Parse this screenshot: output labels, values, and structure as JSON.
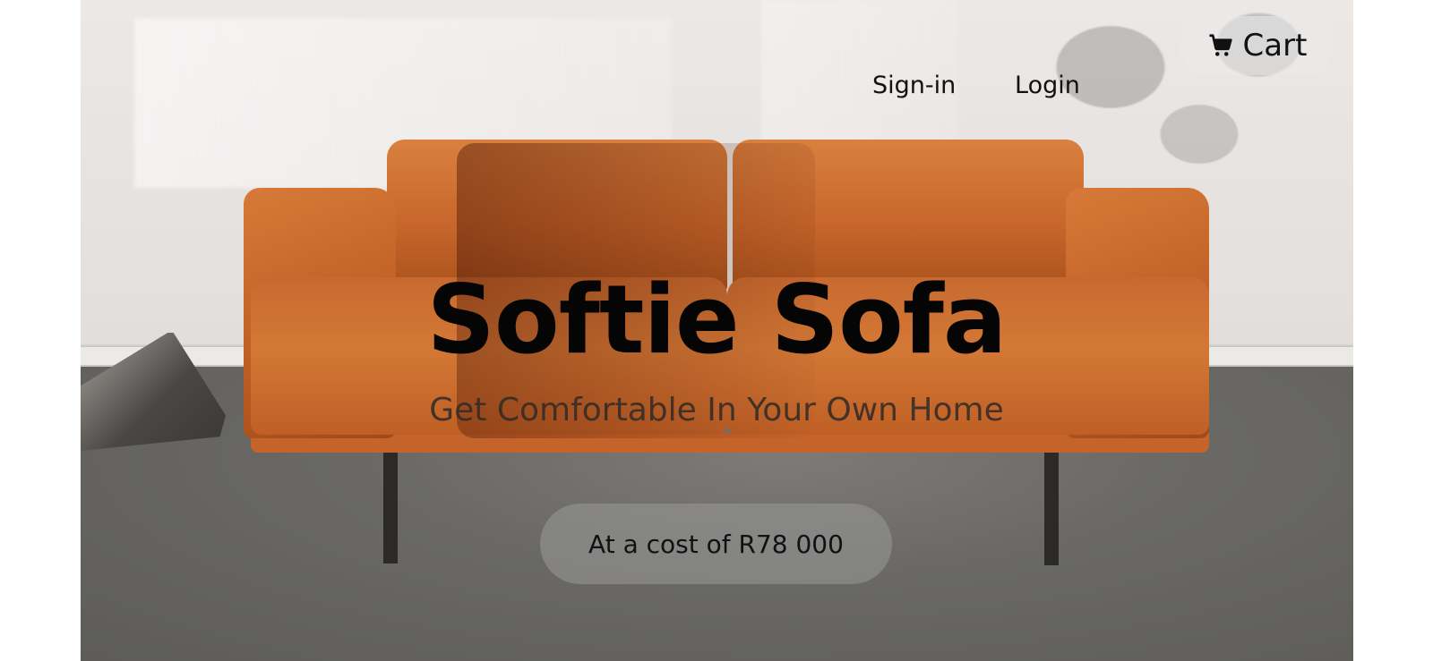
{
  "nav": {
    "signin_label": "Sign-in",
    "login_label": "Login",
    "cart_label": "Cart",
    "cart_icon": "cart-icon"
  },
  "hero": {
    "title": "Softie Sofa",
    "subtitle": "Get Comfortable In Your Own Home",
    "price_text": "At a cost of R78 000"
  },
  "colors": {
    "sofa": "#c8672b",
    "title": "#050505",
    "wall": "#e6e2df",
    "floor": "#6a6965"
  }
}
